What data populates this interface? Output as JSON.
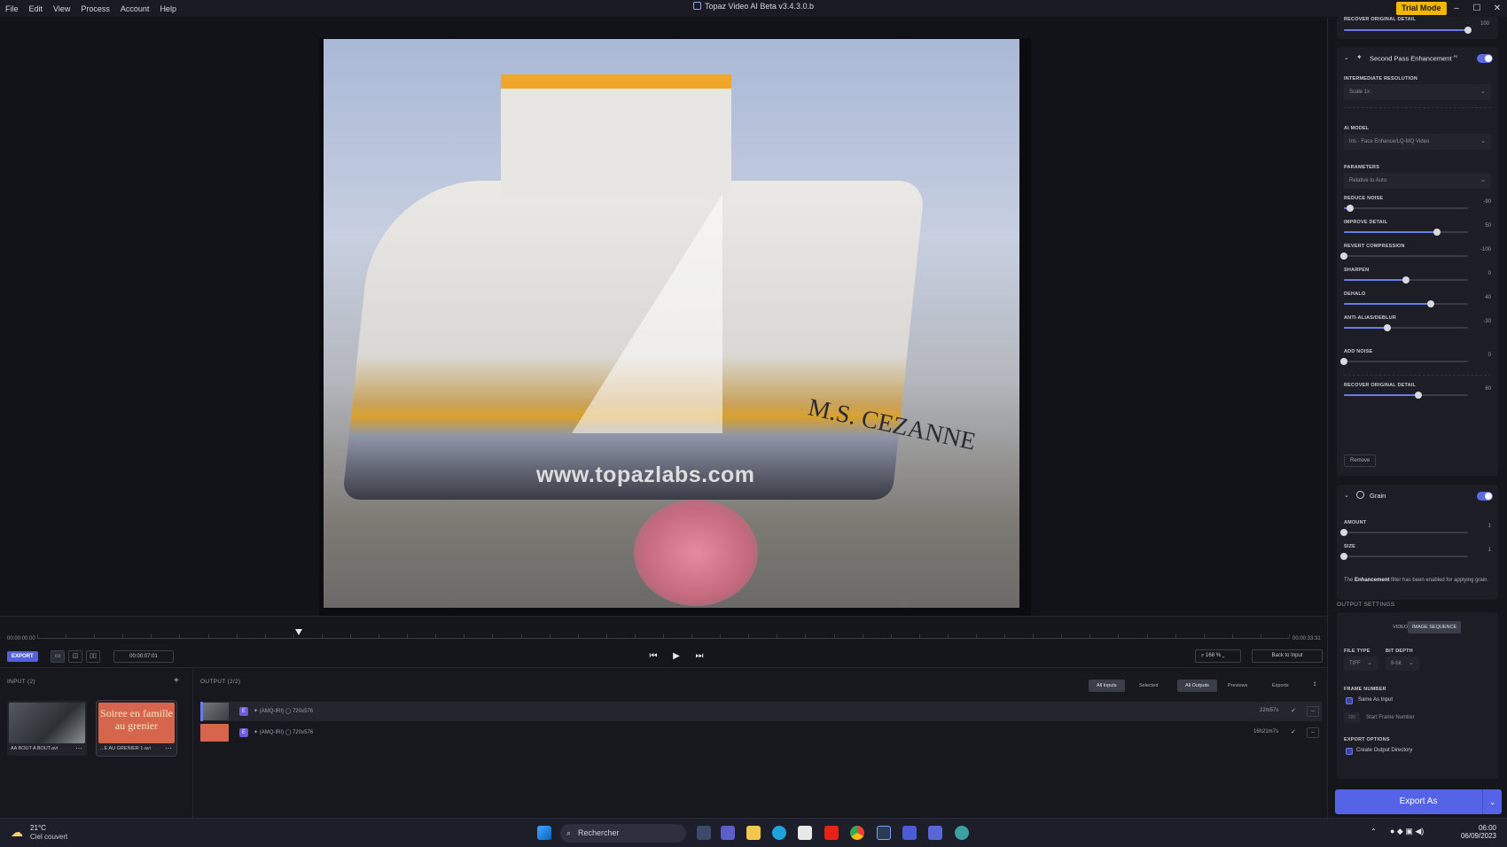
{
  "menubar": {
    "items": [
      "File",
      "Edit",
      "View",
      "Process",
      "Account",
      "Help"
    ],
    "title": "Topaz Video AI Beta  v3.4.3.0.b",
    "trial_badge": "Trial Mode"
  },
  "viewer": {
    "watermark": "www.topazlabs.com",
    "ship_name": "M.S. CEZANNE"
  },
  "timeline": {
    "start_time": "00:00:00:00",
    "end_time": "00:00:33:31",
    "current_timecode": "00:00:07:01",
    "playhead_fraction": 0.209,
    "export_label": "EXPORT",
    "zoom": "168 %",
    "back_to_input": "Back to Input"
  },
  "input_panel": {
    "title": "INPUT (2)",
    "add_icon": "plus-icon",
    "items": [
      {
        "name": "AA BOUT A BOUT.avi"
      },
      {
        "name": "...E AU GRENIER 1.avi",
        "thumb_text": "Soiree en famille au grenier"
      }
    ]
  },
  "output_panel": {
    "title": "OUTPUT (2/2)",
    "filters": [
      "All Inputs",
      "Selected",
      "All Outputs",
      "Previews",
      "Exports"
    ],
    "rows": [
      {
        "badge": "E",
        "model": "(AMQ-IRI)",
        "resolution": "720x576",
        "time": "22m57s"
      },
      {
        "badge": "E",
        "model": "(AMQ-IRI)",
        "resolution": "720x576",
        "time": "16h21m7s"
      }
    ]
  },
  "right_panel": {
    "top_slider": {
      "label": "RECOVER ORIGINAL DETAIL",
      "value": "100",
      "fraction": 1.0
    },
    "second_pass": {
      "title": "Second Pass Enhancement",
      "superscript": "AI",
      "intermediate_label": "INTERMEDIATE RESOLUTION",
      "intermediate_value": "Scale 1x",
      "ai_model_label": "AI MODEL",
      "ai_model_value": "Iris - Face Enhance/LQ-MQ Video",
      "params_label": "PARAMETERS",
      "params_value": "Relative to Auto",
      "sliders": [
        {
          "label": "REDUCE NOISE",
          "value": "-90",
          "fraction": 0.05
        },
        {
          "label": "IMPROVE DETAIL",
          "value": "50",
          "fraction": 0.75
        },
        {
          "label": "REVERT COMPRESSION",
          "value": "-100",
          "fraction": 0.0
        },
        {
          "label": "SHARPEN",
          "value": "0",
          "fraction": 0.5
        },
        {
          "label": "DEHALO",
          "value": "40",
          "fraction": 0.7
        },
        {
          "label": "ANTI-ALIAS/DEBLUR",
          "value": "-30",
          "fraction": 0.35
        },
        {
          "label": "ADD NOISE",
          "value": "0",
          "fraction": 0.0
        },
        {
          "label": "RECOVER ORIGINAL DETAIL",
          "value": "60",
          "fraction": 0.6
        }
      ],
      "remove_label": "Remove"
    },
    "grain": {
      "title": "Grain",
      "sliders": [
        {
          "label": "AMOUNT",
          "value": "1",
          "fraction": 0.0
        },
        {
          "label": "SIZE",
          "value": "1",
          "fraction": 0.0
        }
      ],
      "note_pre": "The ",
      "note_bold": "Enhancement",
      "note_post": " filter has been enabled for applying grain."
    },
    "output_settings": {
      "title": "OUTPUT SETTINGS",
      "tab_video": "VIDEO",
      "tab_image_seq": "IMAGE SEQUENCE",
      "file_type_label": "FILE TYPE",
      "file_type_value": "TIFF",
      "bit_depth_label": "BIT DEPTH",
      "bit_depth_value": "8-bit",
      "frame_number_label": "FRAME NUMBER",
      "same_as_input": "Same As Input",
      "start_frame_value": "200",
      "start_frame_label": "Start Frame Number",
      "export_options_label": "EXPORT OPTIONS",
      "create_dir": "Create Output Directory"
    },
    "export_as": "Export As"
  },
  "taskbar": {
    "temperature": "21°C",
    "weather": "Ciel couvert",
    "search_placeholder": "Rechercher",
    "time": "06:00",
    "date": "06/09/2023"
  },
  "colors": {
    "accent": "#5563e6",
    "trial": "#f2b705",
    "badge": "#6c5bd8"
  }
}
